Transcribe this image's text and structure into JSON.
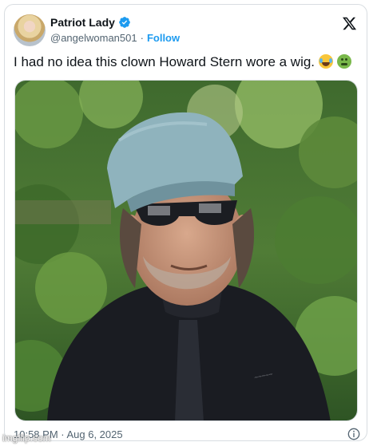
{
  "tweet": {
    "author_name": "Patriot Lady",
    "handle": "@angelwoman501",
    "separator": "·",
    "follow_label": "Follow",
    "text": "I had no idea this clown Howard Stern wore a wig.",
    "emojis": [
      "face-with-tears-of-joy",
      "nauseated-face"
    ],
    "timestamp": "10:58 PM · Aug 6, 2025",
    "verified": true
  },
  "icons": {
    "logo": "x-logo-icon",
    "verified": "verified-badge-icon",
    "info": "info-icon"
  },
  "colors": {
    "accent": "#1d9bf0",
    "text_primary": "#0f1419",
    "text_secondary": "#536471",
    "border": "#d8dde1"
  },
  "watermark": "imgflip.com"
}
